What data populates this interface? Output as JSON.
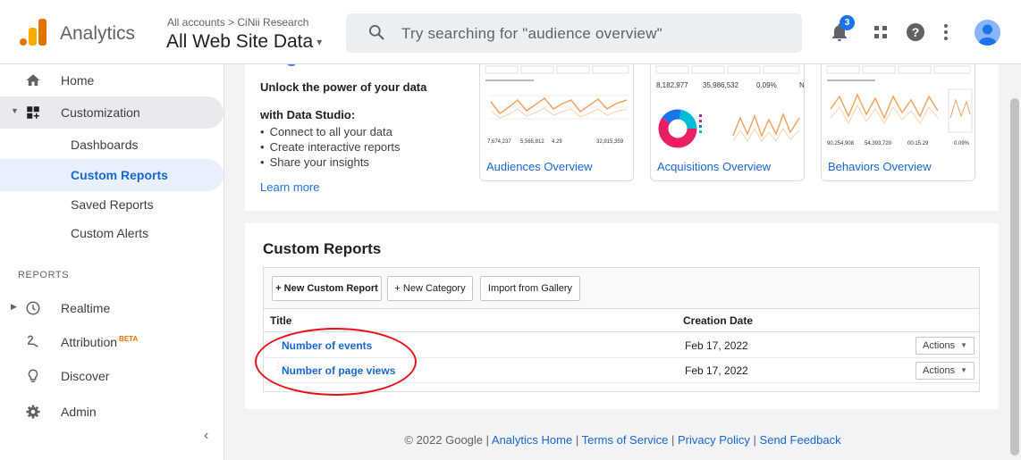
{
  "header": {
    "app_name": "Analytics",
    "breadcrumb": "All accounts > CiNii Research",
    "property": "All Web Site Data",
    "property_caret": "▾",
    "search_placeholder": "Try searching for \"audience overview\"",
    "notification_count": "3",
    "brand_colors": {
      "orange_dark": "#e37400",
      "orange_light": "#f9ab00",
      "accent_blue": "#1a73e8"
    }
  },
  "sidebar": {
    "items": [
      {
        "label": "Home",
        "icon": "home-icon"
      },
      {
        "label": "Customization",
        "icon": "customization-icon"
      },
      {
        "label": "Dashboards"
      },
      {
        "label": "Custom Reports"
      },
      {
        "label": "Saved Reports"
      },
      {
        "label": "Custom Alerts"
      }
    ],
    "section_label": "REPORTS",
    "report_items": [
      {
        "label": "Realtime",
        "icon": "clock-icon"
      },
      {
        "label": "Attribution",
        "badge": "BETA",
        "icon": "attribution-icon"
      },
      {
        "label": "Discover",
        "icon": "lightbulb-icon"
      },
      {
        "label": "Admin",
        "icon": "gear-icon"
      }
    ],
    "collapse_glyph": "‹"
  },
  "datastudio": {
    "title": "Unlock the power of your data",
    "subtitle": "with Data Studio:",
    "bullets": [
      "Connect to all your data",
      "Create interactive reports",
      "Share your insights"
    ],
    "learn_more": "Learn more",
    "thumbnails": [
      {
        "caption": "Audiences Overview",
        "line_color": "#f4a261"
      },
      {
        "caption": "Acquisitions Overview",
        "line_color": "#f4a261"
      },
      {
        "caption": "Behaviors Overview",
        "line_color": "#f4a261"
      }
    ]
  },
  "custom_reports": {
    "title": "Custom Reports",
    "buttons": {
      "new_report": "+ New Custom Report",
      "new_category": "+ New Category",
      "import": "Import from Gallery"
    },
    "columns": {
      "title": "Title",
      "creation_date": "Creation Date"
    },
    "rows": [
      {
        "name": "Number of events",
        "date": "Feb 17, 2022",
        "actions": "Actions"
      },
      {
        "name": "Number of page views",
        "date": "Feb 17, 2022",
        "actions": "Actions"
      }
    ],
    "annotation_color": "#e8101a"
  },
  "footer": {
    "copyright": "© 2022 Google | ",
    "links": [
      "Analytics Home",
      "Terms of Service",
      "Privacy Policy",
      "Send Feedback"
    ],
    "separator": " | "
  }
}
